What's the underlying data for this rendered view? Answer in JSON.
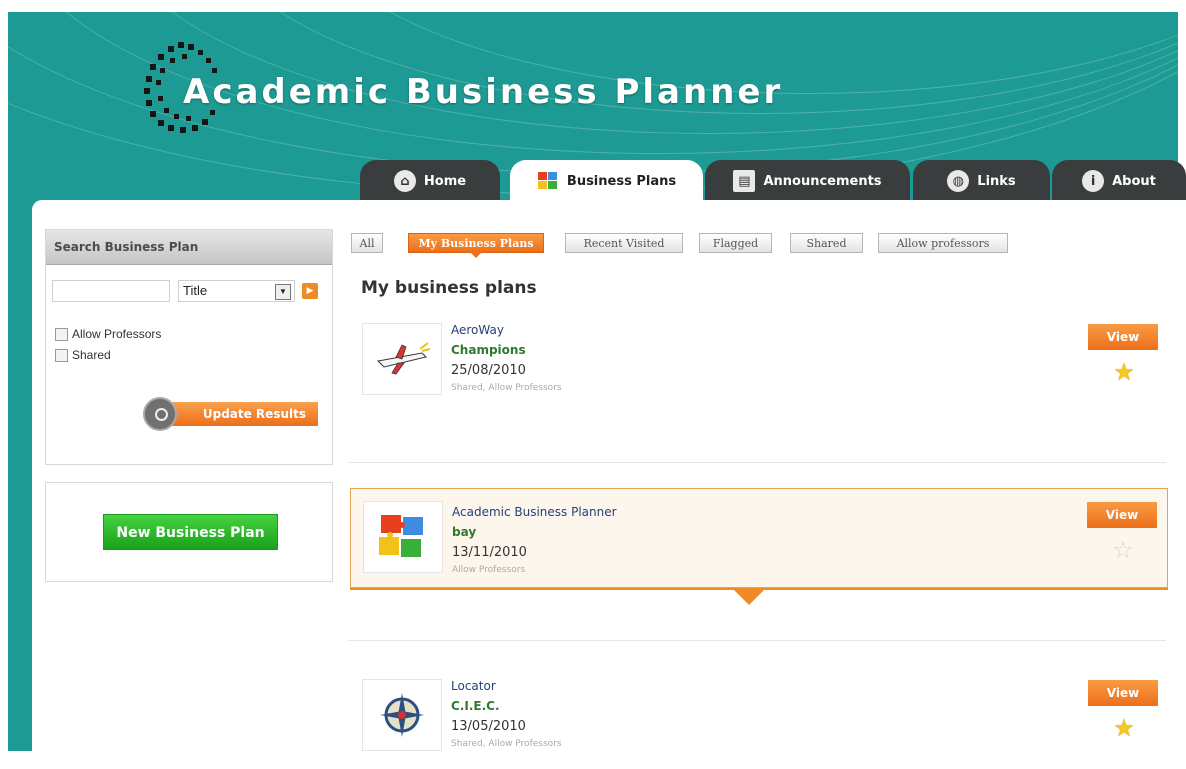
{
  "app": {
    "title": "Academic Business Planner"
  },
  "nav": {
    "tabs": [
      {
        "label": "Home",
        "icon": "home-icon",
        "active": false
      },
      {
        "label": "Business Plans",
        "icon": "puzzle-icon",
        "active": true
      },
      {
        "label": "Announcements",
        "icon": "newspaper-icon",
        "active": false
      },
      {
        "label": "Links",
        "icon": "globe-icon",
        "active": false
      },
      {
        "label": "About",
        "icon": "info-icon",
        "active": false
      }
    ]
  },
  "search": {
    "heading": "Search Business Plan",
    "query": "",
    "field_selected": "Title",
    "checkboxes": [
      {
        "label": "Allow Professors",
        "checked": false
      },
      {
        "label": "Shared",
        "checked": false
      }
    ],
    "update_label": "Update Results"
  },
  "new_plan": {
    "label": "New Business Plan"
  },
  "filters": [
    {
      "label": "All",
      "active": false
    },
    {
      "label": "My Business Plans",
      "active": true
    },
    {
      "label": "Recent Visited",
      "active": false
    },
    {
      "label": "Flagged",
      "active": false
    },
    {
      "label": "Shared",
      "active": false
    },
    {
      "label": "Allow professors",
      "active": false
    }
  ],
  "main": {
    "heading": "My business plans",
    "plans": [
      {
        "name": "AeroWay",
        "owner": "Champions",
        "date": "25/08/2010",
        "meta": "Shared, Allow Professors",
        "view_label": "View",
        "flagged": true,
        "thumb": "airplane-icon"
      },
      {
        "name": "Academic Business Planner",
        "owner": "bay",
        "date": "13/11/2010",
        "meta": "Allow Professors",
        "view_label": "View",
        "flagged": false,
        "thumb": "puzzle-icon"
      },
      {
        "name": "Locator",
        "owner": "C.I.E.C.",
        "date": "13/05/2010",
        "meta": "Shared, Allow Professors",
        "view_label": "View",
        "flagged": true,
        "thumb": "compass-icon"
      }
    ]
  },
  "colors": {
    "teal": "#1e9a94",
    "orange": "#ec6f1a",
    "green": "#1aa11a",
    "tab_dark": "#3a3d3e"
  }
}
